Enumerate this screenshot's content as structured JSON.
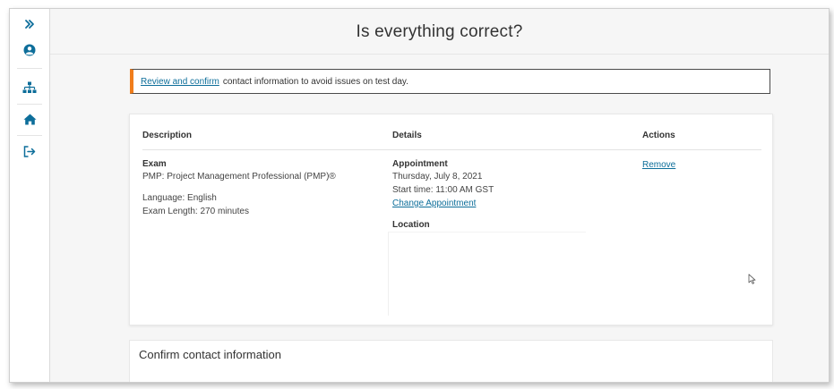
{
  "sidebar": {
    "items": [
      {
        "name": "expand",
        "icon": "double-chevron-right-icon"
      },
      {
        "name": "profile",
        "icon": "user-circle-icon"
      },
      {
        "name": "sitemap",
        "icon": "sitemap-icon"
      },
      {
        "name": "home",
        "icon": "home-icon"
      },
      {
        "name": "sign-out",
        "icon": "sign-out-icon"
      }
    ],
    "accent_color": "#0d6e9a"
  },
  "header": {
    "title": "Is everything correct?"
  },
  "alert": {
    "link_text": "Review and confirm",
    "message": "contact information to avoid issues on test day.",
    "accent_color": "#f07d1b"
  },
  "table": {
    "headers": {
      "description": "Description",
      "details": "Details",
      "actions": "Actions"
    },
    "row": {
      "exam_label": "Exam",
      "exam_name": "PMP: Project Management Professional (PMP)®",
      "language": "Language: English",
      "exam_length": "Exam Length: 270 minutes",
      "appointment_label": "Appointment",
      "appointment_date": "Thursday, July 8, 2021",
      "start_time": "Start time: 11:00 AM GST",
      "change_link": "Change Appointment",
      "location_label": "Location",
      "remove_link": "Remove"
    }
  },
  "contact_section": {
    "title": "Confirm contact information"
  }
}
